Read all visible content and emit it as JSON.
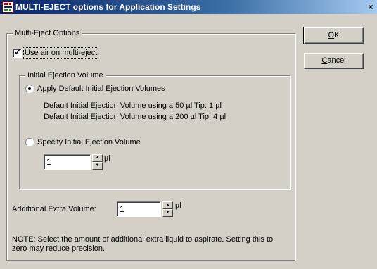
{
  "window": {
    "title": "MULTI-EJECT options for Application Settings",
    "close_label": "×"
  },
  "buttons": {
    "ok_label": "K",
    "ok_mnemonic": "O",
    "cancel_label": "ancel",
    "cancel_mnemonic": "C"
  },
  "multi_eject": {
    "group_label": "Multi-Eject Options",
    "use_air_label": "Use air on multi-eject",
    "use_air_checked": true
  },
  "initial_ejection": {
    "group_label": "Initial Ejection Volume",
    "apply_default_label": "Apply Default Initial Ejection Volumes",
    "apply_default_selected": true,
    "default_50_text": "Default Initial Ejection Volume using a 50 µl Tip: 1 µl",
    "default_200_text": "Default Initial Ejection Volume using a 200 µl Tip: 4 µl",
    "specify_label": "Specify Initial Ejection Volume",
    "specify_selected": false,
    "volume_value": "1",
    "volume_unit": "µl"
  },
  "additional": {
    "label": "Additional Extra Volume:",
    "value": "1",
    "unit": "µl",
    "note": "NOTE: Select the amount of additional extra liquid to aspirate. Setting this to zero may reduce precision."
  },
  "icons": {
    "app": "application-icon",
    "close": "close-icon",
    "checkmark": "checkmark-icon",
    "spin_up": "up-arrow-icon",
    "spin_down": "down-arrow-icon"
  },
  "colors": {
    "titlebar_start": "#0a246a",
    "titlebar_end": "#a6caf0",
    "dialog_background": "#d4d0c8"
  }
}
